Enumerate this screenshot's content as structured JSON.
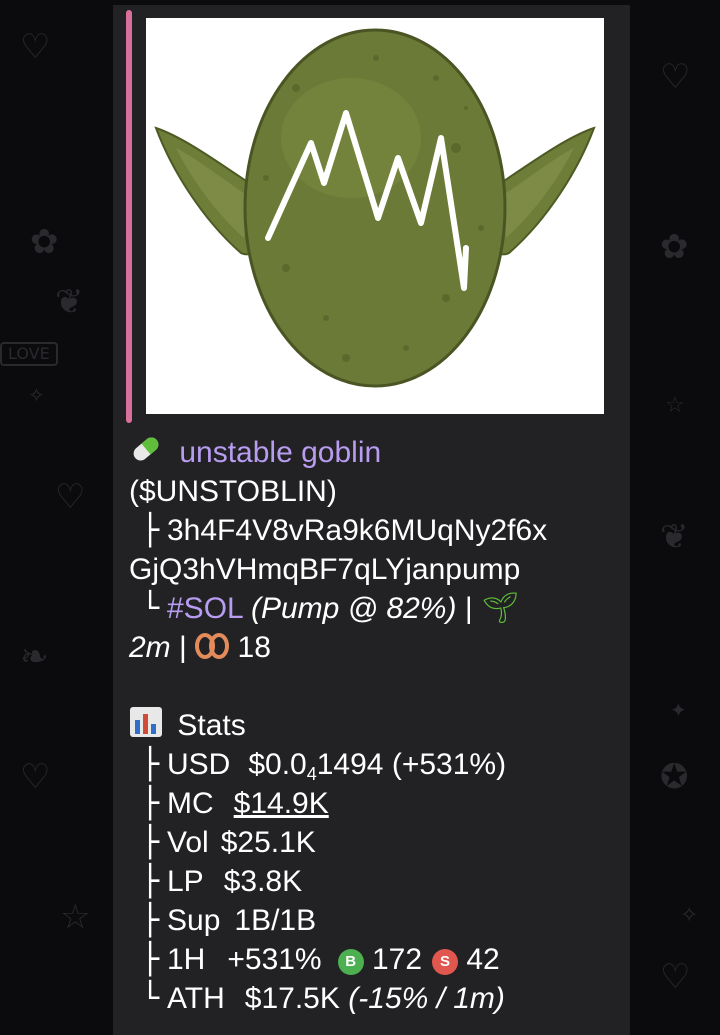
{
  "background": {
    "color": "#0b0b0d",
    "doodle_color": "#2a2a2e",
    "love_sign_text": "LOVE"
  },
  "card": {
    "background": "#222224",
    "accent_bar_color": "#d9709b"
  },
  "token": {
    "icon": "pill-icon",
    "name": "unstable goblin",
    "ticker": "($UNSTOBLIN)",
    "address_line1": "3h4F4V8vRa9k6MUqNy2f6x",
    "address_line2": "GjQ3hVHmqBF7qLYjanpump",
    "chain": "#SOL",
    "pump": "(Pump @ 82%)",
    "sep": "|",
    "age_icon": "seedling-icon",
    "age": "2m",
    "holders_icon": "eyes-icon",
    "holders": "18"
  },
  "stats": {
    "icon": "bar-chart-icon",
    "title": "Stats",
    "usd_label": "USD",
    "usd_prefix": "$0.0",
    "usd_sub": "4",
    "usd_rest": "1494",
    "usd_change": "(+531%)",
    "mc_label": "MC",
    "mc_value": "$14.9K",
    "vol_label": "Vol",
    "vol_value": "$25.1K",
    "lp_label": "LP",
    "lp_value": "$3.8K",
    "sup_label": "Sup",
    "sup_value": "1B/1B",
    "h1_label": "1H",
    "h1_change": "+531%",
    "buy_badge": "B",
    "buys": "172",
    "sell_badge": "S",
    "sells": "42",
    "ath_label": "ATH",
    "ath_value": "$17.5K",
    "ath_detail": "(-15% / 1m)"
  },
  "colors": {
    "accent_purple": "#b79cf0",
    "buy_green": "#4caf50",
    "sell_red": "#e0574f",
    "goblin_green": "#6b7a36"
  }
}
